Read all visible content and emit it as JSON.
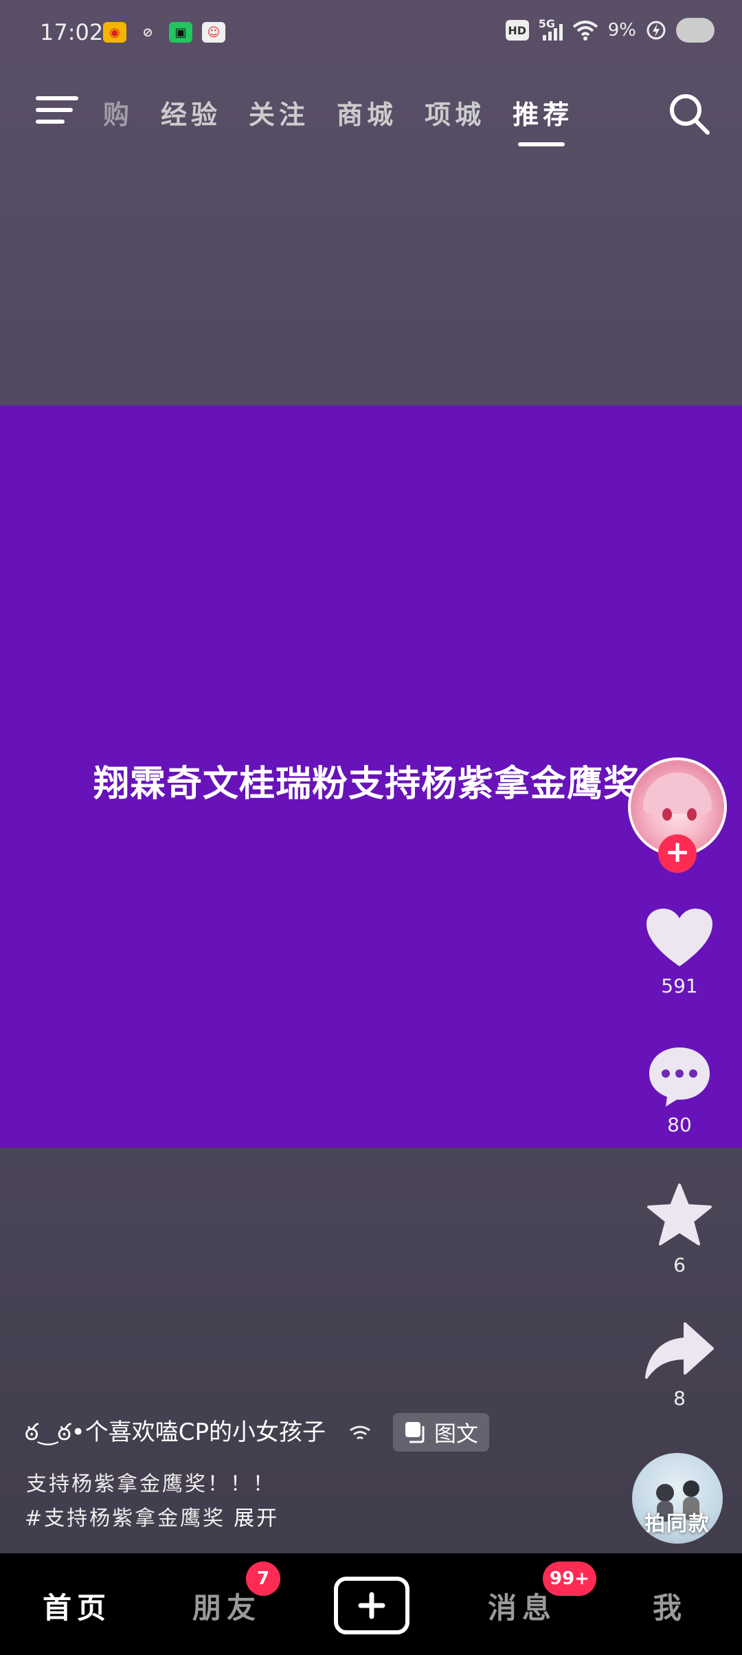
{
  "status_bar": {
    "time": "17:02",
    "network": "5G",
    "hd": "HD",
    "battery": "9%"
  },
  "top_nav": {
    "tabs": [
      {
        "label": "购",
        "active": false
      },
      {
        "label": "经验",
        "active": false
      },
      {
        "label": "关注",
        "active": false
      },
      {
        "label": "商城",
        "active": false
      },
      {
        "label": "项城",
        "active": false
      },
      {
        "label": "推荐",
        "active": true
      }
    ]
  },
  "post": {
    "title": "翔霖奇文桂瑞粉支持杨紫拿金鹰奖",
    "background_color": "#6713b9",
    "author": "ఠ‿ఠ•个喜欢嗑CP的小女孩子",
    "type_badge": "图文",
    "caption": "支持杨紫拿金鹰奖！！！",
    "hashtag": "#支持杨紫拿金鹰奖",
    "expand_label": "展开"
  },
  "actions": {
    "likes": "591",
    "comments": "80",
    "favorites": "6",
    "shares": "8",
    "same_style_label": "拍同款"
  },
  "bottom_nav": {
    "home": "首页",
    "friends": "朋友",
    "friends_badge": "7",
    "messages": "消息",
    "messages_badge": "99+",
    "me": "我"
  },
  "colors": {
    "accent_red": "#fe2c55",
    "content_purple": "#6713b9"
  }
}
